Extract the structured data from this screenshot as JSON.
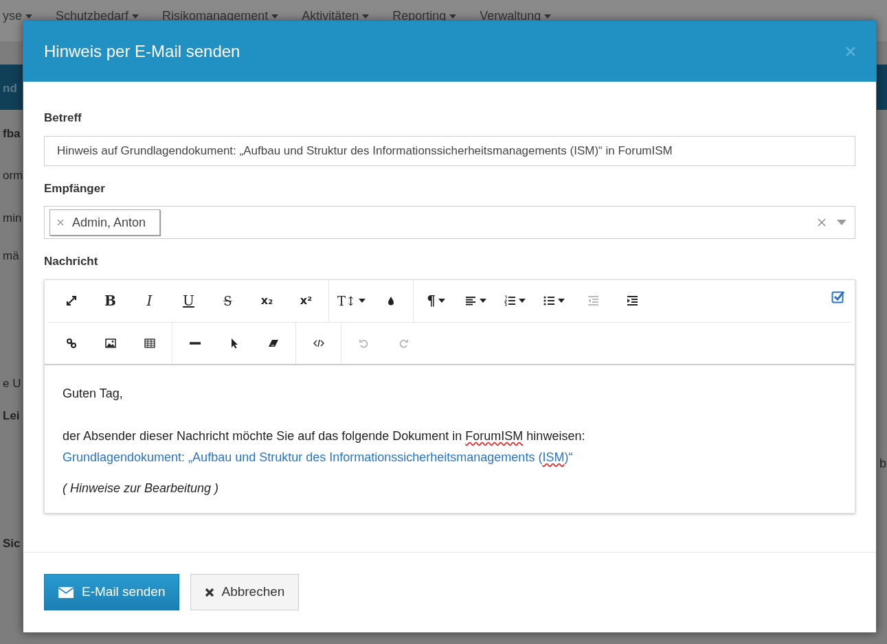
{
  "background": {
    "nav": [
      "yse",
      "Schutzbedarf",
      "Risikomanagement",
      "Aktivitäten",
      "Reporting",
      "Verwaltung"
    ],
    "fragments": [
      "nd",
      "fba",
      "orm",
      "min",
      "mä",
      "e U",
      "Lei",
      "Sic"
    ],
    "right_text": "b"
  },
  "modal": {
    "title": "Hinweis per E-Mail senden",
    "fields": [
      {
        "kind": "text",
        "label": "Betreff",
        "value": "Hinweis auf Grundlagendokument: „Aufbau und Struktur des Informationssicherheitsmanagements (ISM)“ in ForumISM"
      },
      {
        "kind": "tags",
        "label": "Empfänger",
        "tags": [
          "Admin, Anton"
        ]
      }
    ],
    "editor": {
      "label": "Nachricht",
      "source_checked": true,
      "toolbar": [
        [
          [
            {
              "kind": "fullscreen"
            },
            {
              "kind": "bold",
              "label": "B"
            },
            {
              "kind": "italic",
              "label": "I"
            },
            {
              "kind": "underline",
              "label": "U"
            },
            {
              "kind": "strike",
              "label": "S"
            },
            {
              "kind": "subscript",
              "label": "x₂"
            },
            {
              "kind": "superscript",
              "label": "x²"
            }
          ],
          [
            {
              "kind": "fontsize",
              "label": "T↕",
              "dropdown": true
            },
            {
              "kind": "color"
            }
          ],
          [
            {
              "kind": "paragraph",
              "label": "¶",
              "dropdown": true
            },
            {
              "kind": "align",
              "dropdown": true
            },
            {
              "kind": "ol",
              "dropdown": true
            },
            {
              "kind": "ul",
              "dropdown": true
            },
            {
              "kind": "outdent",
              "disabled": true
            },
            {
              "kind": "indent"
            }
          ]
        ],
        [
          [
            {
              "kind": "link"
            },
            {
              "kind": "image"
            },
            {
              "kind": "table"
            }
          ],
          [
            {
              "kind": "hr"
            },
            {
              "kind": "pointer"
            },
            {
              "kind": "eraser"
            }
          ],
          [
            {
              "kind": "code"
            }
          ],
          [
            {
              "kind": "undo",
              "disabled": true
            },
            {
              "kind": "redo",
              "disabled": true
            }
          ]
        ]
      ],
      "content": [
        {
          "kind": "text",
          "segments": [
            {
              "text": "Guten Tag,"
            }
          ]
        },
        {
          "kind": "blank"
        },
        {
          "kind": "text",
          "segments": [
            {
              "text": "der Absender dieser Nachricht möchte Sie auf das folgende Dokument in "
            },
            {
              "text": "ForumISM",
              "misspelled": true
            },
            {
              "text": " hinweisen:"
            }
          ]
        },
        {
          "kind": "link",
          "segments": [
            {
              "text": "Grundlagendokument: „Aufbau und Struktur des Informationssicherheitsmanagements ("
            },
            {
              "text": "ISM",
              "misspelled": true
            },
            {
              "text": ")“"
            }
          ]
        },
        {
          "kind": "note",
          "segments": [
            {
              "text": "( Hinweise zur Bearbeitung )"
            }
          ]
        }
      ]
    },
    "buttons": [
      {
        "kind": "primary",
        "label": "E-Mail senden"
      },
      {
        "kind": "secondary",
        "label": "Abbrechen"
      }
    ]
  }
}
